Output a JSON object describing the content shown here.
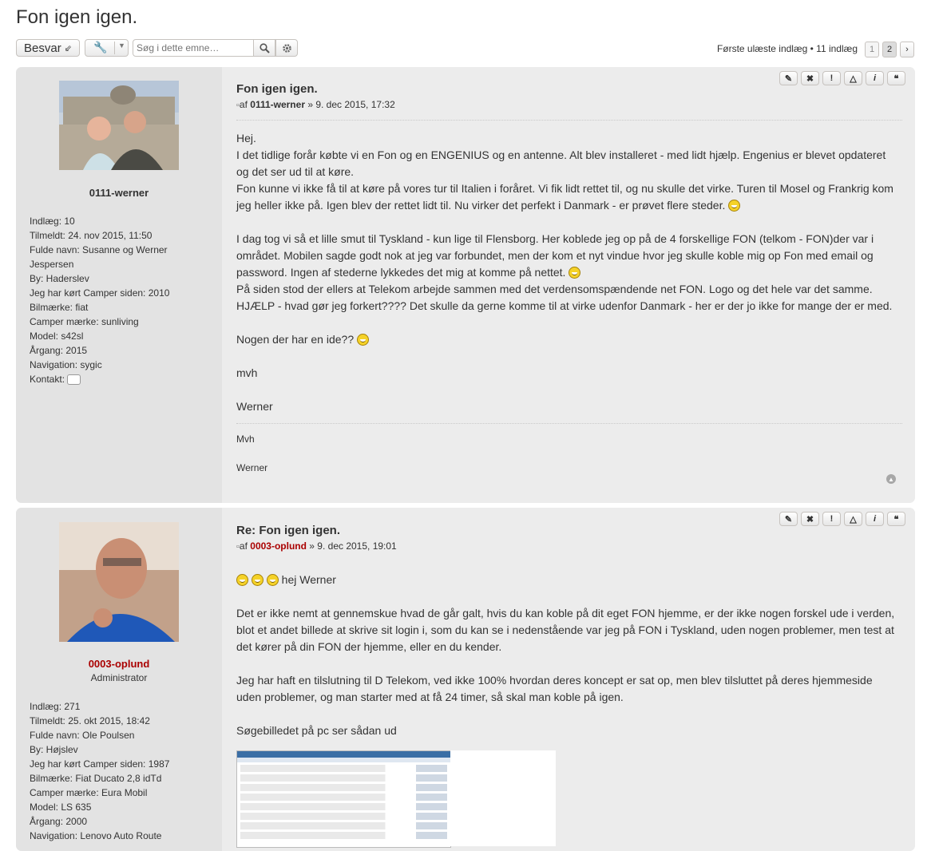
{
  "topic": {
    "title": "Fon igen igen."
  },
  "action_bar": {
    "reply_label": "Besvar",
    "search_placeholder": "Søg i dette emne…",
    "pagination_text": "Første ulæste indlæg • 11 indlæg",
    "pages": [
      "1",
      "2"
    ]
  },
  "posts": [
    {
      "title": "Fon igen igen.",
      "by": "af",
      "author": "0111-werner",
      "date": "» 9. dec 2015, 17:32",
      "username": "0111-werner",
      "fields": [
        "Indlæg: 10",
        "Tilmeldt: 24. nov 2015, 11:50",
        "Fulde navn: Susanne og Werner Jespersen",
        "By: Haderslev",
        "Jeg har kørt Camper siden: 2010",
        "Bilmærke: fiat",
        "Camper mærke: sunliving",
        "Model: s42sl",
        "Årgang: 2015",
        "Navigation: sygic"
      ],
      "contact_label": "Kontakt:",
      "content": [
        "Hej.",
        "I det tidlige forår købte vi en Fon og en ENGENIUS og en antenne. Alt blev installeret - med lidt hjælp. Engenius er blevet opdateret og det ser ud til at køre.",
        "Fon kunne vi ikke få til at køre på vores tur til Italien i foråret. Vi fik lidt rettet til, og nu skulle det virke. Turen til Mosel og Frankrig kom jeg heller ikke på. Igen blev der rettet lidt til. Nu virker det perfekt i Danmark - er prøvet flere steder.",
        "I dag tog vi så et lille smut til Tyskland - kun lige til Flensborg. Her koblede jeg op på de 4 forskellige FON (telkom - FON)der var i området. Mobilen sagde godt nok at jeg var forbundet, men der kom et nyt vindue hvor jeg skulle koble mig op Fon med email og password. Ingen af stederne lykkedes det mig at komme på nettet.",
        "På siden stod der ellers at Telekom arbejde sammen med det verdensomspændende net FON. Logo og det hele var det samme.",
        "HJÆLP - hvad gør jeg forkert???? Det skulle da gerne komme til at virke udenfor Danmark - her er der jo ikke for mange der er med.",
        "Nogen der har en ide??",
        "mvh",
        "Werner"
      ],
      "signature": [
        "Mvh",
        "Werner"
      ]
    },
    {
      "title": "Re: Fon igen igen.",
      "by": "af",
      "author": "0003-oplund",
      "date": "» 9. dec 2015, 19:01",
      "username": "0003-oplund",
      "rank": "Administrator",
      "fields": [
        "Indlæg: 271",
        "Tilmeldt: 25. okt 2015, 18:42",
        "Fulde navn: Ole Poulsen",
        "By: Højslev",
        "Jeg har kørt Camper siden: 1987",
        "Bilmærke: Fiat Ducato 2,8 idTd",
        "Camper mærke: Eura Mobil",
        "Model: LS 635",
        "Årgang: 2000",
        "Navigation: Lenovo Auto Route"
      ],
      "content": [
        "hej Werner",
        "Det er ikke nemt at gennemskue hvad de går galt, hvis du kan koble på dit eget FON hjemme, er der ikke nogen forskel ude i verden, blot et andet billede at skrive sit login i, som du kan se i nedenstående var jeg på FON i Tyskland, uden nogen problemer, men test at det kører på din FON der hjemme, eller en du kender.",
        "Jeg har haft en tilslutning til D Telekom, ved ikke 100% hvordan deres koncept er sat op, men blev tilsluttet på deres hjemmeside uden problemer, og man starter med at få 24 timer, så skal man koble på igen.",
        "Søgebilledet på pc ser sådan ud"
      ]
    }
  ]
}
